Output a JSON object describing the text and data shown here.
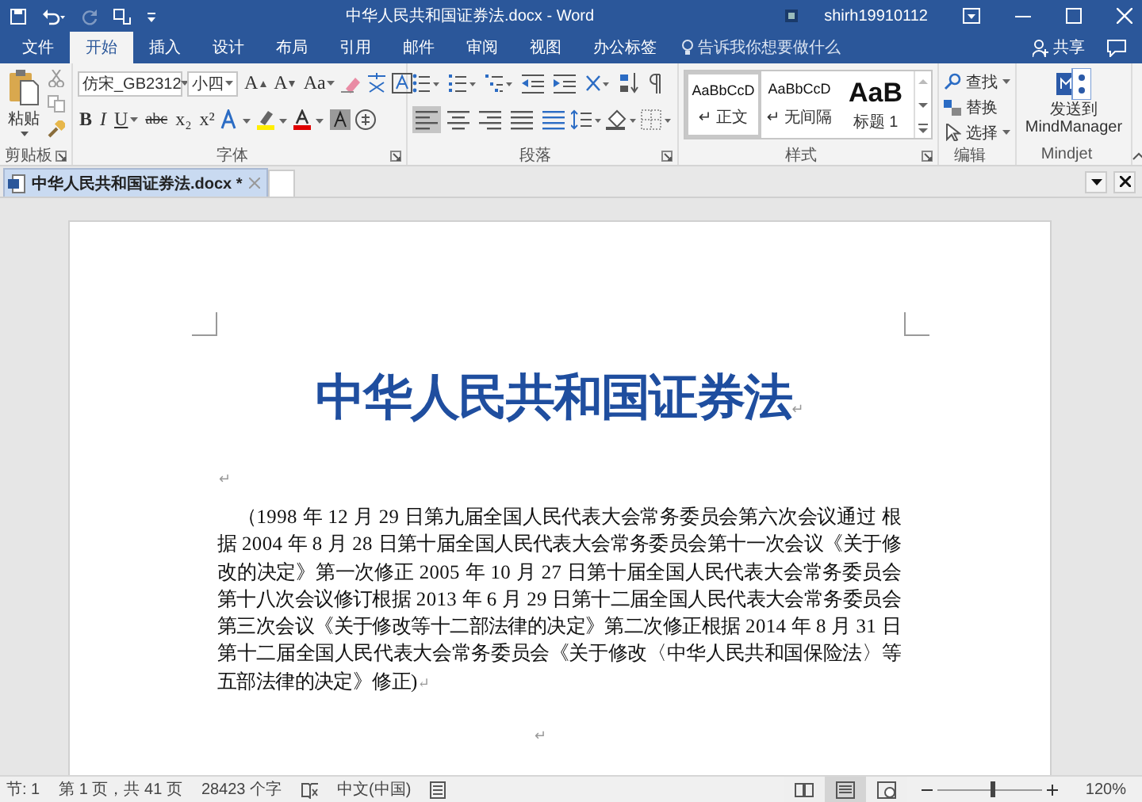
{
  "window": {
    "title": "中华人民共和国证券法.docx - Word",
    "user": "shirh19910112"
  },
  "quick_access": {
    "redo": {
      "disabled": true
    }
  },
  "ribbon_tabs": [
    {
      "label": "文件",
      "selected": false
    },
    {
      "label": "开始",
      "selected": true
    },
    {
      "label": "插入",
      "selected": false
    },
    {
      "label": "设计",
      "selected": false
    },
    {
      "label": "布局",
      "selected": false
    },
    {
      "label": "引用",
      "selected": false
    },
    {
      "label": "邮件",
      "selected": false
    },
    {
      "label": "审阅",
      "selected": false
    },
    {
      "label": "视图",
      "selected": false
    },
    {
      "label": "办公标签",
      "selected": false
    }
  ],
  "tell_me": {
    "placeholder": "告诉我你想要做什么"
  },
  "share": "共享",
  "ribbon": {
    "clipboard": {
      "paste": "粘贴",
      "label": "剪贴板"
    },
    "font": {
      "name": "仿宋_GB2312",
      "size": "小四",
      "size_buttons": [
        "A",
        "A",
        "Aa"
      ],
      "format_buttons": [
        "B",
        "I",
        "U",
        "abc",
        "x₂",
        "x²"
      ],
      "label": "字体"
    },
    "paragraph": {
      "align_buttons": [
        {
          "kind": "left",
          "selected": true
        },
        {
          "kind": "center",
          "selected": false
        },
        {
          "kind": "right",
          "selected": false
        },
        {
          "kind": "justify",
          "selected": false
        },
        {
          "kind": "distributed",
          "selected": false
        }
      ],
      "label": "段落"
    },
    "styles": {
      "items": [
        {
          "kind": "body",
          "sample": "AaBbCcD",
          "name": "↵ 正文",
          "selected": true
        },
        {
          "kind": "body",
          "sample": "AaBbCcD",
          "name": "↵ 无间隔",
          "selected": false
        },
        {
          "kind": "heading",
          "sample": "AaB",
          "name": "标题 1",
          "selected": false
        }
      ],
      "label": "样式"
    },
    "editing": {
      "items": [
        {
          "kind": "find",
          "label": "查找"
        },
        {
          "kind": "replace",
          "label": "替换"
        },
        {
          "kind": "select",
          "label": "选择"
        }
      ],
      "label": "编辑"
    },
    "mindjet": {
      "button": "发送到 MindManager",
      "label": "Mindjet"
    }
  },
  "document_tabs": [
    {
      "label": "中华人民共和国证券法.docx *",
      "selected": true
    }
  ],
  "document": {
    "title": "中华人民共和国证券法",
    "title_mark": "↵",
    "empty_mark": "↵",
    "body": "（1998 年 12 月 29 日第九届全国人民代表大会常务委员会第六次会议通过 根据 2004 年 8 月 28 日第十届全国人民代表大会常务委员会第十一次会议《关于修改的决定》第一次修正 2005 年 10 月 27 日第十届全国人民代表大会常务委员会第十八次会议修订根据 2013 年 6 月 29 日第十二届全国人民代表大会常务委员会第三次会议《关于修改等十二部法律的决定》第二次修正根据 2014 年 8 月 31 日第十二届全国人民代表大会常务委员会《关于修改〈中华人民共和国保险法〉等五部法律的决定》修正)",
    "body_mark": "↵",
    "end_mark": "↵"
  },
  "status_bar": {
    "section": "节: 1",
    "page": "第 1 页，共 41 页",
    "words": "28423 个字",
    "language": "中文(中国)",
    "views": [
      {
        "kind": "read",
        "selected": false
      },
      {
        "kind": "print",
        "selected": true
      },
      {
        "kind": "web",
        "selected": false
      }
    ],
    "zoom": {
      "level": 0.52
    },
    "zoom_text": "120%"
  }
}
